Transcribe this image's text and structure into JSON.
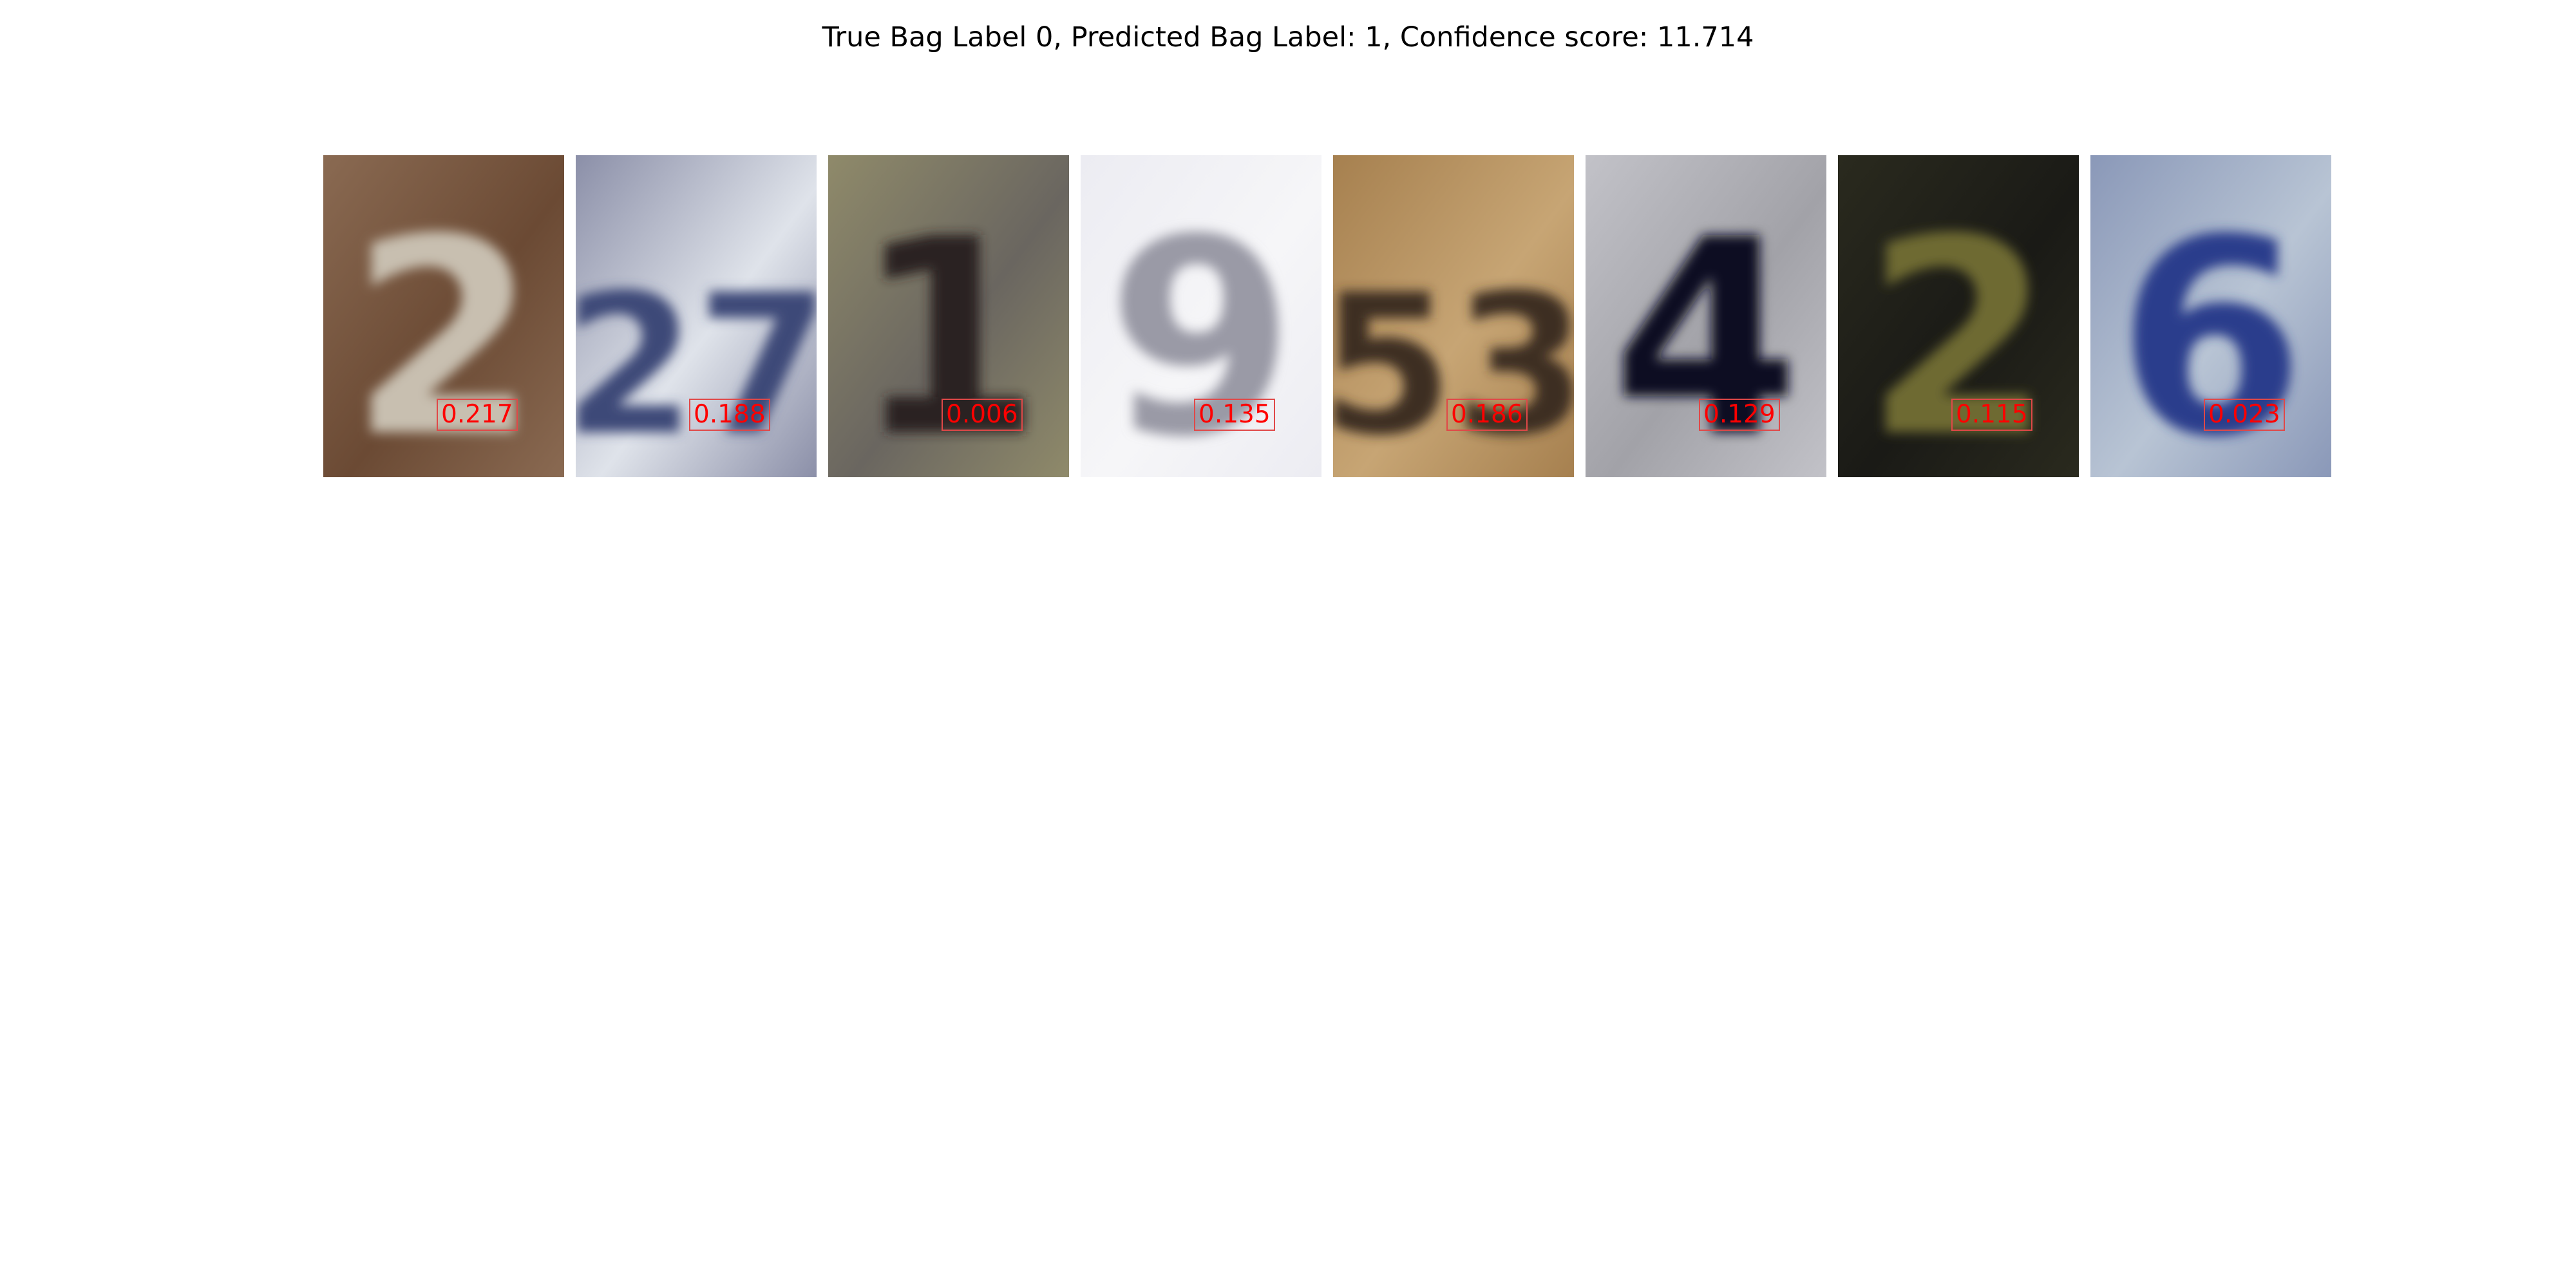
{
  "title": "True Bag Label 0, Predicted Bag Label: 1, Confidence score: 11.714",
  "instances": [
    {
      "digit": "2",
      "score": "0.217",
      "bg": "#6b4a34",
      "bg2": "#8a6a52",
      "fg": "#c8bfb0"
    },
    {
      "digit": "27",
      "score": "0.188",
      "bg": "#dfe3ea",
      "bg2": "#8b8fa8",
      "fg": "#3c4a78"
    },
    {
      "digit": "1",
      "score": "0.006",
      "bg": "#6a6660",
      "bg2": "#8f8a6a",
      "fg": "#2a2420"
    },
    {
      "digit": "9",
      "score": "0.135",
      "bg": "#f6f6f8",
      "bg2": "#ececf2",
      "fg": "#9a9aa6"
    },
    {
      "digit": "53",
      "score": "0.186",
      "bg": "#c7a574",
      "bg2": "#a6804f",
      "fg": "#3c2e22"
    },
    {
      "digit": "4",
      "score": "0.129",
      "bg": "#a2a2a8",
      "bg2": "#c2c2c8",
      "fg": "#0c1024"
    },
    {
      "digit": "2",
      "score": "0.115",
      "bg": "#1a1a16",
      "bg2": "#2a2a1e",
      "fg": "#6e6a30"
    },
    {
      "digit": "6",
      "score": "0.023",
      "bg": "#b8c4d4",
      "bg2": "#8a98b8",
      "fg": "#2a3c8c"
    }
  ]
}
